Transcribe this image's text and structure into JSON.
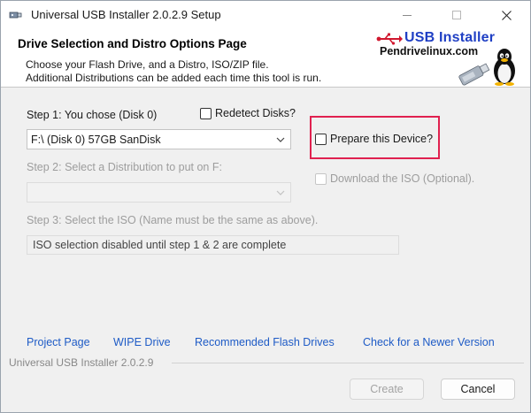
{
  "window": {
    "title": "Universal USB Installer 2.0.2.9 Setup"
  },
  "header": {
    "title": "Drive Selection and Distro Options Page",
    "description_line1": "Choose your Flash Drive, and a Distro, ISO/ZIP file.",
    "description_line2": "Additional Distributions can be added each time this tool is run.",
    "brand_name": "USB Installer",
    "brand_url": "Pendrivelinux.com"
  },
  "step1": {
    "label": "Step 1: You chose (Disk 0)",
    "redetect_label": "Redetect Disks?",
    "drive_selected": "F:\\ (Disk 0) 57GB SanDisk",
    "prepare_label": "Prepare this Device?"
  },
  "step2": {
    "label": "Step 2: Select a Distribution to put on F:",
    "distro_selected": "",
    "download_label": "Download the ISO (Optional)."
  },
  "step3": {
    "label": "Step 3: Select the ISO (Name must be the same as above).",
    "iso_text": "ISO selection disabled until step 1 & 2 are complete"
  },
  "links": [
    {
      "label": "Project Page"
    },
    {
      "label": "WIPE Drive"
    },
    {
      "label": "Recommended Flash Drives"
    },
    {
      "label": "Check for a Newer Version"
    }
  ],
  "footer": {
    "version_label": "Universal USB Installer 2.0.2.9",
    "create_label": "Create",
    "cancel_label": "Cancel"
  },
  "colors": {
    "accent_link": "#1e5bc6",
    "highlight_border": "#e0214f",
    "brand_blue": "#1f3fc4"
  }
}
